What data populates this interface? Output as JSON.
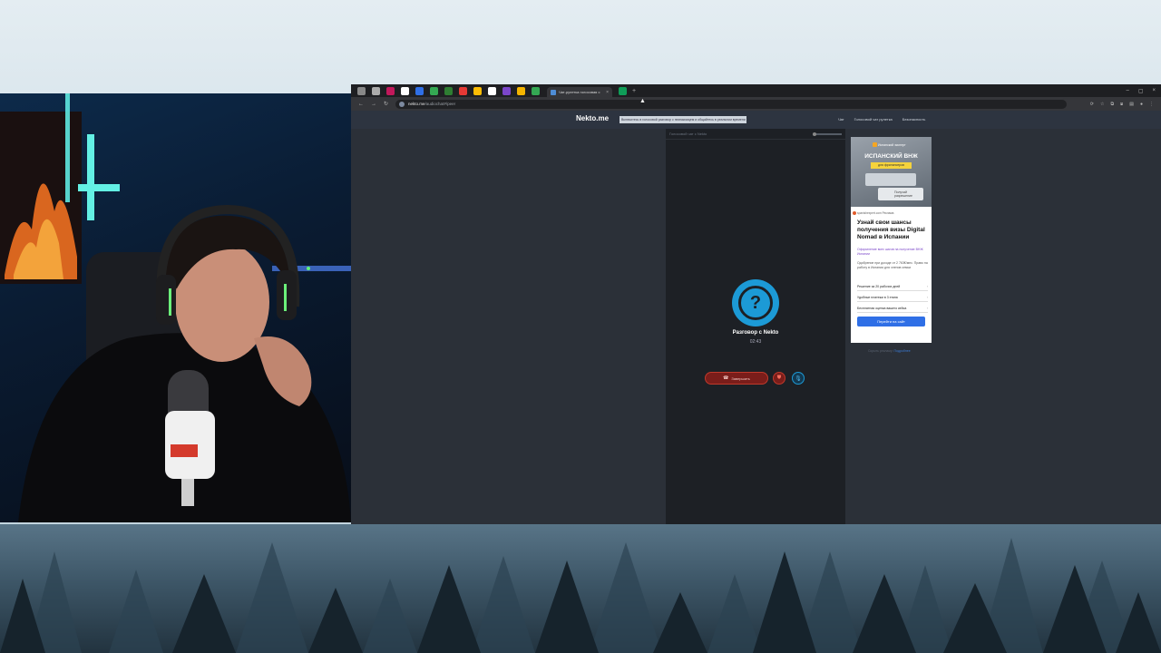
{
  "browser": {
    "active_tab_title": "Чат-рулетка голосовая с",
    "tab_close": "×",
    "new_tab": "+",
    "tab_colors": [
      "#888888",
      "#aaaaaa",
      "#c2185b",
      "#ffffff",
      "#2f6fe6",
      "#34a853",
      "#2e7d32",
      "#e53935",
      "#fbbc05",
      "#ffffff",
      "#7b46c9",
      "#f4b400",
      "#34a853",
      "#0f9d58"
    ],
    "window_controls": [
      "–",
      "▢",
      "×"
    ],
    "url_host": "nekto.me",
    "url_path": "/audiochat#/peer",
    "nav": {
      "back": "←",
      "forward": "→",
      "reload": "↻"
    },
    "toolbar_icons": [
      "⟳",
      "☆",
      "⧉",
      "⧈",
      "▤",
      "●",
      "⋮"
    ]
  },
  "site": {
    "logo": "Nekto.me",
    "alert_banner": "Включитесь в голосовой разговор с незнакомцем и общайтесь в реальном времени",
    "nav": [
      "Чат",
      "Голосовой чат рулетка",
      "Безопасность"
    ]
  },
  "chat": {
    "header_title": "Голосовой чат с Nekto",
    "call_icon": "?",
    "call_title": "Разговор с Nekto",
    "call_timer": "02:43",
    "end_button_label": "Завершить",
    "end_button_icon": "☎",
    "report_icon": "⛊",
    "mic_icon": "🎙"
  },
  "ad": {
    "image_brand": "Испанский эксперт",
    "image_headline": "ИСПАНСКИЙ ВНЖ",
    "image_tag": "для фрилансеров",
    "image_card": "Получай разрешение",
    "domain": "spanishexpert.com  Реклама",
    "title": "Узнай свои шансы получения визы Digital Nomad в Испании",
    "subtitle": "Оформление всех шагов на получение ВНЖ Испании",
    "description": "Одобрение при доходе от 2 763€/мес. Право на работу в Испании для членов семьи",
    "rows": [
      "Решение за 20 рабочих дней",
      "Удобные платежи в 3 этапа",
      "Бесплатная оценка вашего кейса"
    ],
    "row_chevron": "›",
    "cta": "Перейти на сайт",
    "footer_text": "Скрыть рекламу:",
    "footer_link": "Подробнее"
  },
  "cursor": "▲"
}
